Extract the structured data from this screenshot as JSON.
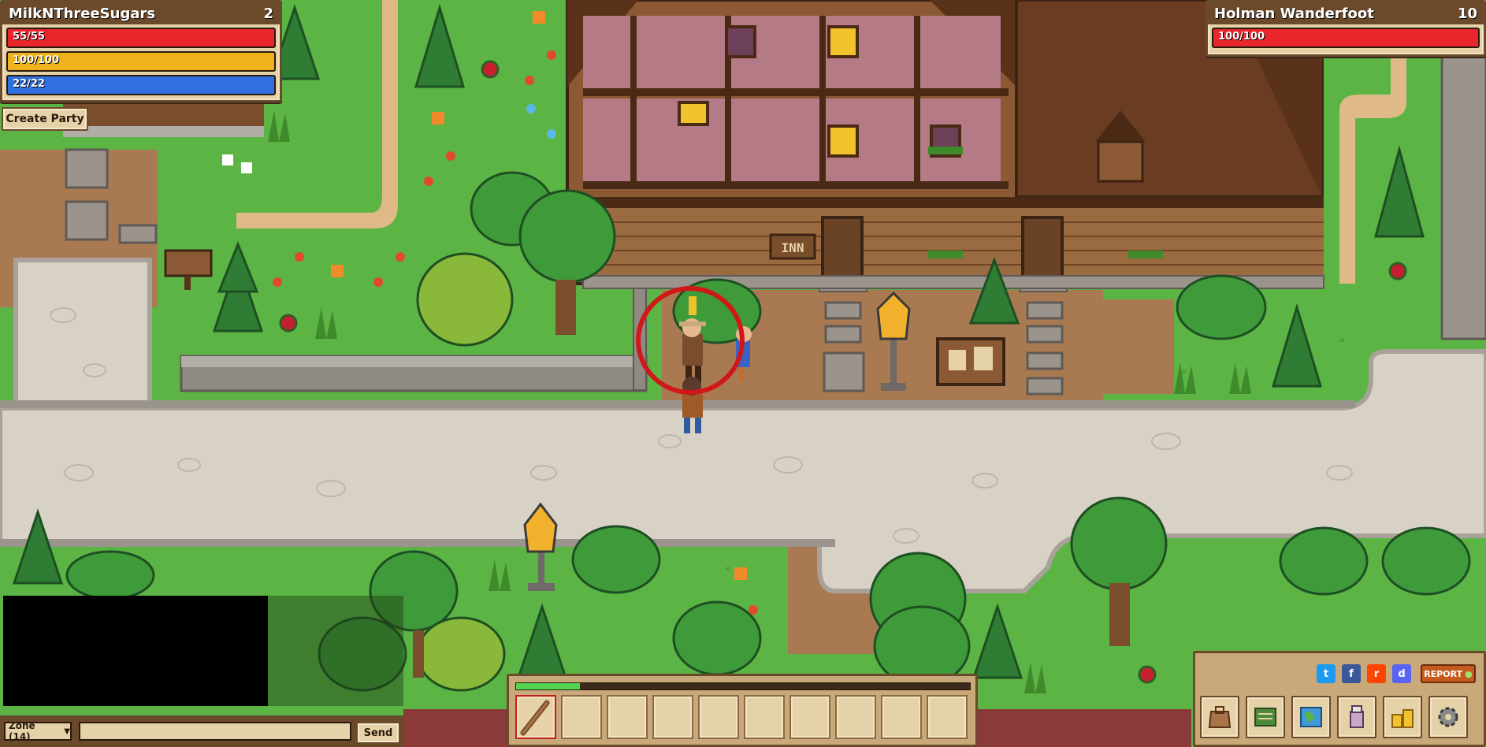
{
  "player": {
    "name": "MilkNThreeSugars",
    "level": "2",
    "health": "55/55",
    "stamina": "100/100",
    "mana": "22/22",
    "health_fraction": 1.0,
    "stamina_fraction": 1.0,
    "mana_fraction": 1.0
  },
  "party": {
    "create_label": "Create Party"
  },
  "target": {
    "name": "Holman Wanderfoot",
    "level": "10",
    "health": "100/100",
    "health_fraction": 1.0
  },
  "world": {
    "inn_sign": "INN"
  },
  "chat": {
    "channel": "Zone (14)",
    "input_value": "",
    "send_label": "Send"
  },
  "hotbar": {
    "xp_fraction": 0.14,
    "slots": [
      "staff",
      "",
      "",
      "",
      "",
      "",
      "",
      "",
      "",
      ""
    ]
  },
  "menu": {
    "report_label": "REPORT",
    "social": [
      "twitter-icon",
      "facebook-icon",
      "reddit-icon",
      "discord-icon"
    ],
    "buttons": [
      "inventory-icon",
      "quest-log-icon",
      "map-icon",
      "character-icon",
      "gold-icon",
      "settings-icon"
    ]
  },
  "colors": {
    "health": "#e8262c",
    "stamina": "#f0b21b",
    "mana": "#2f6fe0",
    "xp": "#52d652",
    "panel": "#e6d2a8",
    "panel_border": "#6b4a2b",
    "grass": "#5cb445",
    "path": "#d8d2c6",
    "target_ring": "#d01818"
  }
}
